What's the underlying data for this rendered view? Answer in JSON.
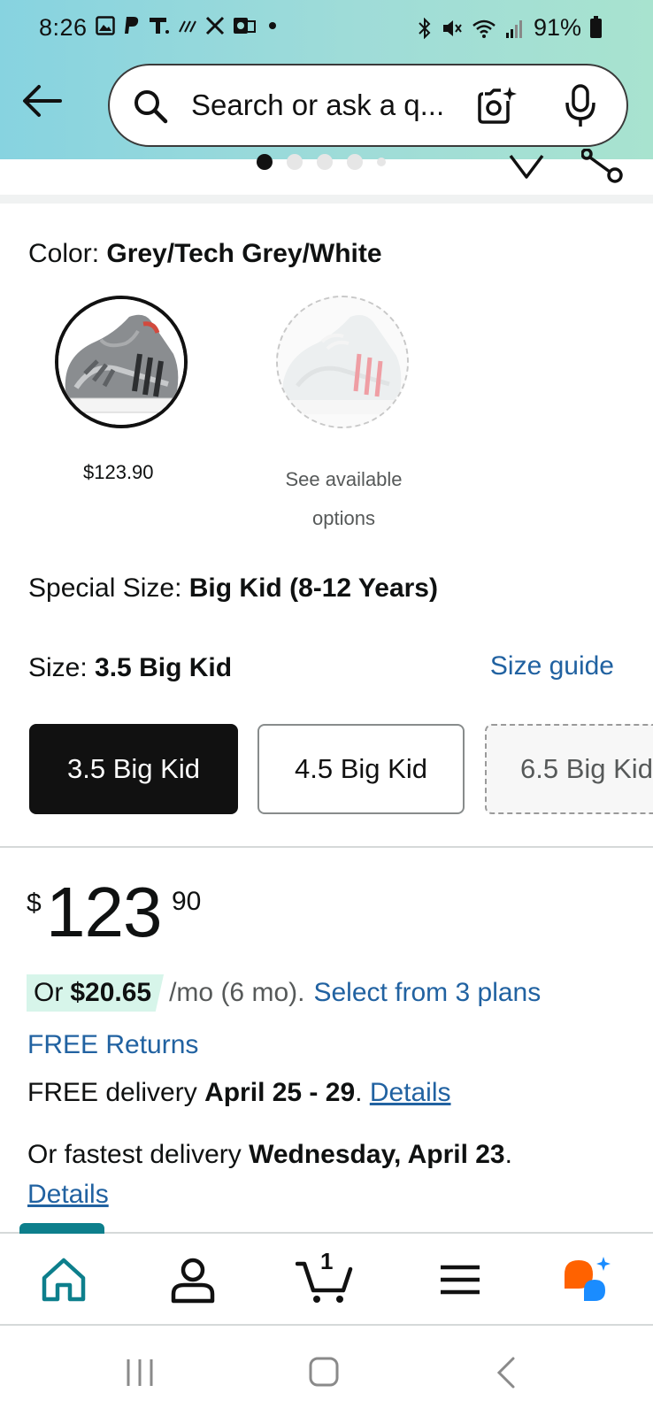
{
  "status_bar": {
    "time": "8:26",
    "left_icons": [
      "gallery-icon",
      "paypal-icon",
      "t-app-icon",
      "signal-app-icon",
      "x-icon",
      "outlook-icon",
      "dot-icon"
    ],
    "right_icons": [
      "bluetooth-icon",
      "mute-icon",
      "wifi-icon",
      "cell-signal-icon"
    ],
    "battery": "91%"
  },
  "search": {
    "placeholder": "Search or ask a q...",
    "icons": [
      "back-arrow-icon",
      "search-icon",
      "camera-icon",
      "mic-icon"
    ]
  },
  "image_carousel": {
    "dot_count": 5,
    "active_index": 0
  },
  "color": {
    "label": "Color: ",
    "value": "Grey/Tech Grey/White",
    "swatches": [
      {
        "price": "$123.90",
        "selected": true
      },
      {
        "note": "See available options",
        "selected": false
      }
    ]
  },
  "special_size": {
    "label": "Special Size: ",
    "value": "Big Kid (8-12 Years)"
  },
  "size": {
    "label": "Size: ",
    "value": "3.5 Big Kid",
    "guide": "Size guide",
    "options": [
      {
        "label": "3.5 Big Kid",
        "state": "selected"
      },
      {
        "label": "4.5 Big Kid",
        "state": "available"
      },
      {
        "label": "6.5 Big Kid",
        "state": "unavailable"
      }
    ]
  },
  "price": {
    "symbol": "$",
    "whole": "123",
    "fraction": "90"
  },
  "installment": {
    "prefix": "Or",
    "amount": "$20.65",
    "term": "/mo (6 mo).",
    "link": "Select from 3 plans"
  },
  "returns": "FREE Returns",
  "delivery": {
    "prefix": "FREE delivery ",
    "dates": "April 25 - 29",
    "separator": ". ",
    "details": "Details"
  },
  "fastest": {
    "prefix": "Or fastest delivery ",
    "date": "Wednesday, April 23",
    "suffix": ".",
    "details": "Details"
  },
  "bottom_nav": {
    "items": [
      "home-icon",
      "account-icon",
      "cart-icon",
      "menu-icon",
      "rufus-icon"
    ],
    "cart_count": "1",
    "active": "home"
  },
  "colors": {
    "link": "#2162a1",
    "accent": "#0d7f8c",
    "installment_bg": "#d7f5ea",
    "selected_size_bg": "#111111"
  }
}
